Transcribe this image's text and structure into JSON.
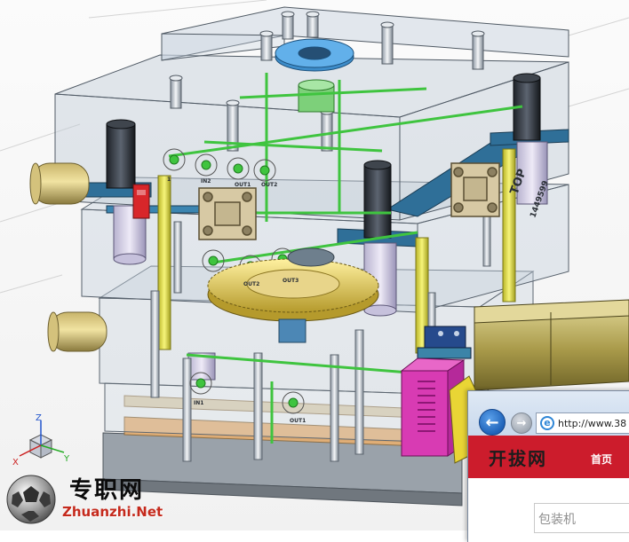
{
  "cad_view": {
    "plate_labels": [
      "TOP",
      "1449599",
      "1",
      "OUT1",
      "OUT2",
      "IN2",
      "OUT2",
      "OUT3",
      "IN1",
      "OUT1"
    ],
    "triad": {
      "x_label": "X",
      "y_label": "Y",
      "z_label": "Z"
    },
    "colors": {
      "background": "#f4f4f4",
      "water_line": "#3fc43f",
      "support_pillar": "#f0ee5a",
      "locating_ring": "#4aa3e0",
      "plate_steel": "#b9c8d6"
    }
  },
  "watermark": {
    "logo_text": "专职网",
    "url": "Zhuanzhi.Net"
  },
  "browser": {
    "back_icon": "back-arrow-icon",
    "forward_icon": "forward-arrow-icon",
    "address_text": "http://www.38",
    "site_logo": "开拔网",
    "nav_home": "首页",
    "search_placeholder": "包装机",
    "colors": {
      "header": "#cc1c2c"
    }
  }
}
